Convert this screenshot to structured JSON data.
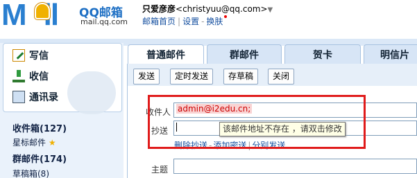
{
  "header": {
    "logo_text": "M",
    "logo_text2": "il",
    "brand": "QQ邮箱",
    "brand_url": "mail.qq.com",
    "user_name": "只爱彦彦",
    "user_email": "<christyuu@qq.com>",
    "links": [
      "邮箱首页",
      "设置",
      "换肤"
    ]
  },
  "sidebar": {
    "actions": [
      {
        "label": "写信",
        "icon": "pencil-icon"
      },
      {
        "label": "收信",
        "icon": "inbox-icon"
      },
      {
        "label": "通讯录",
        "icon": "contacts-icon"
      }
    ],
    "folders": [
      {
        "label": "收件箱(127)"
      },
      {
        "label": "星标邮件"
      },
      {
        "label": "群邮件(174)"
      },
      {
        "label": "草稿箱(8)"
      }
    ]
  },
  "tabs": [
    "普通邮件",
    "群邮件",
    "贺卡",
    "明信片"
  ],
  "toolbar": {
    "send": "发送",
    "schedule": "定时发送",
    "save_draft": "存草稿",
    "close": "关闭"
  },
  "compose": {
    "to_label": "收件人",
    "to_value": "admin@i2edu.cn;",
    "cc_label": "抄送",
    "tooltip": "该邮件地址不存在 ，请双击修改",
    "remove_cc": "删除抄送",
    "add_bcc": "添加密送",
    "separate_send": "分别发送",
    "subject_label": "主题"
  },
  "colors": {
    "accent_blue": "#2a7fd0",
    "highlight_red": "#e01b1b"
  }
}
